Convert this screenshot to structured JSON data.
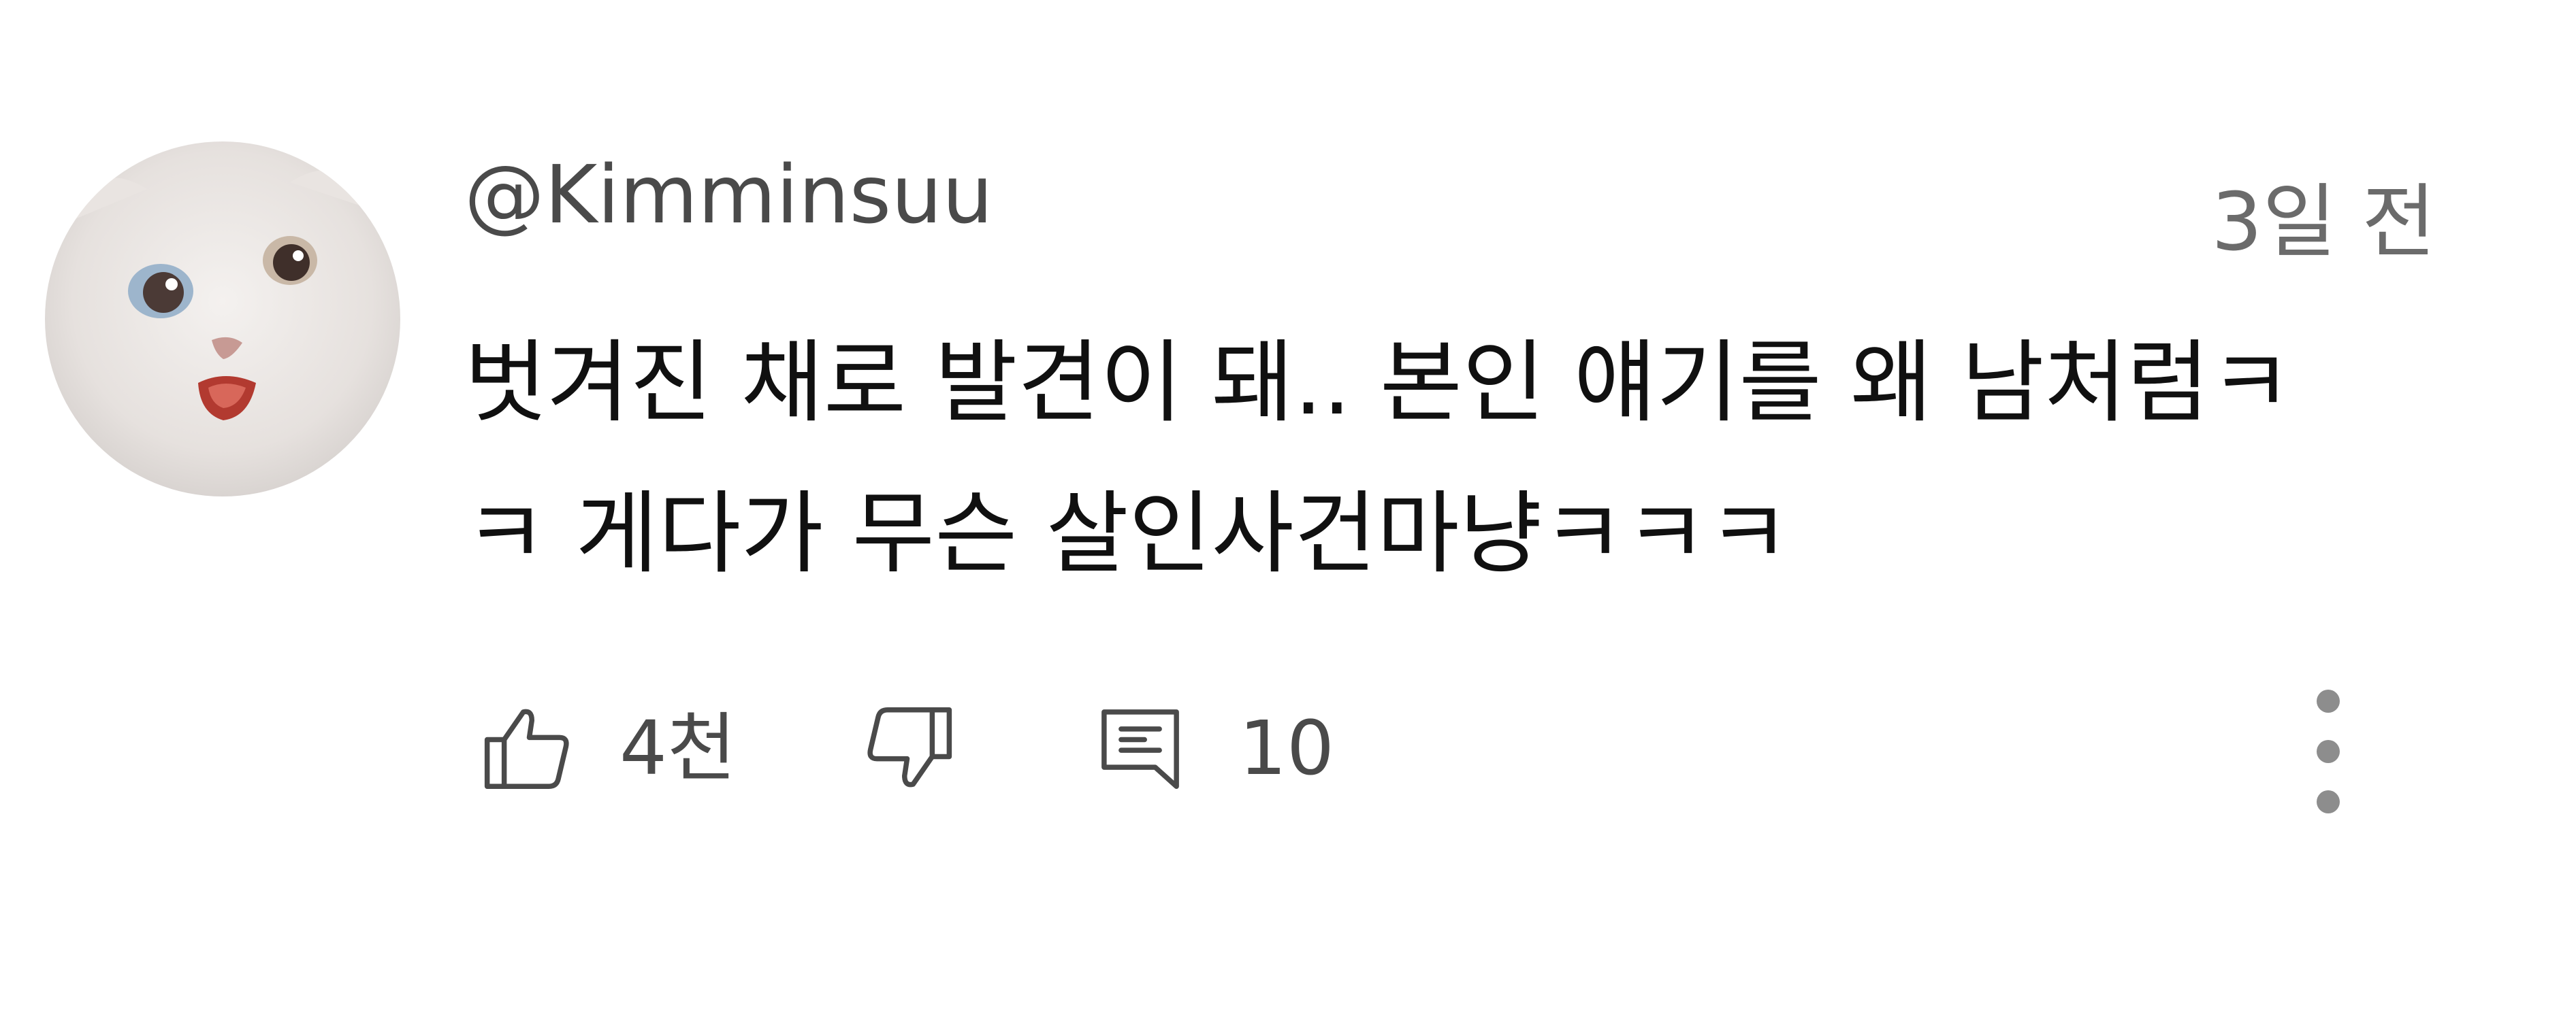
{
  "comment": {
    "avatar_icon": "white-kitten-avatar",
    "username": "@Kimminsuu",
    "timestamp": "3일 전",
    "text_lines": [
      "벗겨진 채로 발견이 돼.. 본인 얘기를 왜 남처럼ㅋ",
      "ㅋ 게다가 무슨 살인사건마냥ㅋㅋㅋ"
    ],
    "actions": {
      "like_icon": "thumbs-up-icon",
      "like_count": "4천",
      "dislike_icon": "thumbs-down-icon",
      "reply_icon": "comment-icon",
      "reply_count": "10",
      "more_icon": "more-vertical-icon"
    }
  },
  "colors": {
    "text_primary": "#101010",
    "text_secondary": "#4a4a4a",
    "icon_stroke": "#4a4a4a",
    "more_dots": "#8d8d8d"
  }
}
